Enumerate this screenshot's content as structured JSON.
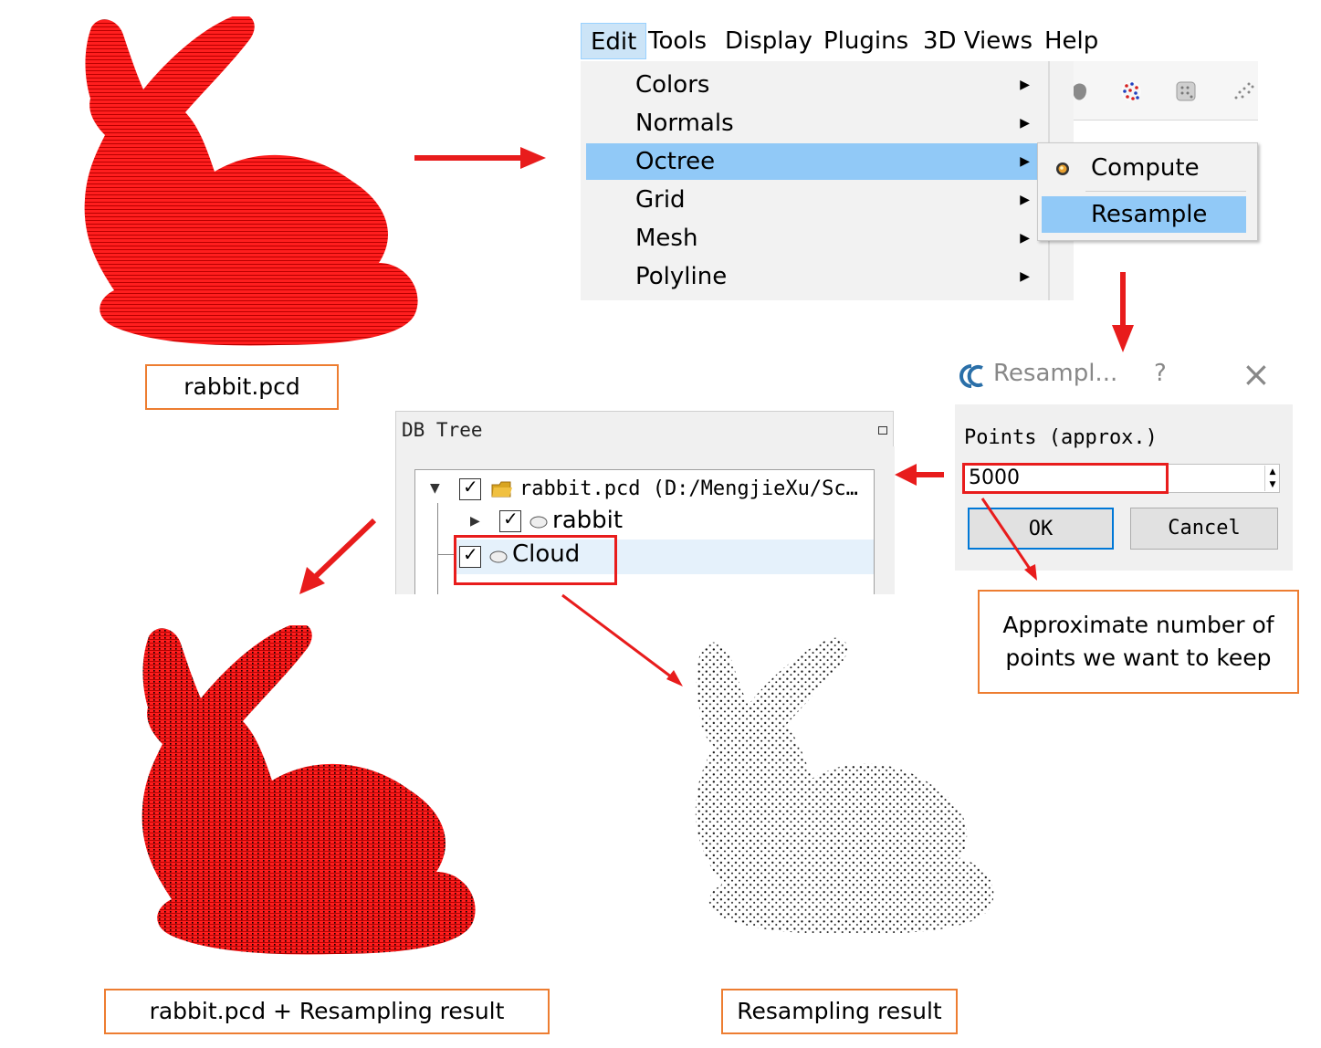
{
  "captions": {
    "original": "rabbit.pcd",
    "combined": "rabbit.pcd + Resampling result",
    "result": "Resampling result",
    "note": "Approximate number of points we want to keep"
  },
  "menubar": {
    "items": [
      "Edit",
      "Tools",
      "Display",
      "Plugins",
      "3D Views",
      "Help"
    ],
    "active": "Edit"
  },
  "edit_menu": {
    "items": [
      "Colors",
      "Normals",
      "Octree",
      "Grid",
      "Mesh",
      "Polyline"
    ],
    "highlighted": "Octree"
  },
  "octree_submenu": {
    "items": [
      "Compute",
      "Resample"
    ],
    "highlighted": "Resample"
  },
  "dialog": {
    "title": "Resampl...",
    "help_glyph": "?",
    "close_glyph": "×",
    "points_label": "Points (approx.)",
    "points_value": "5000",
    "ok_label": "OK",
    "cancel_label": "Cancel"
  },
  "db_tree": {
    "title": "DB Tree",
    "file_node": "rabbit.pcd (D:/MengjieXu/Sc…",
    "child_node": "rabbit",
    "new_node": "Cloud"
  },
  "colors": {
    "arrow": "#e81c1c",
    "caption_border": "#ed7d31",
    "cloud_red": "#ff1a1a",
    "menu_highlight": "#91c9f7"
  }
}
